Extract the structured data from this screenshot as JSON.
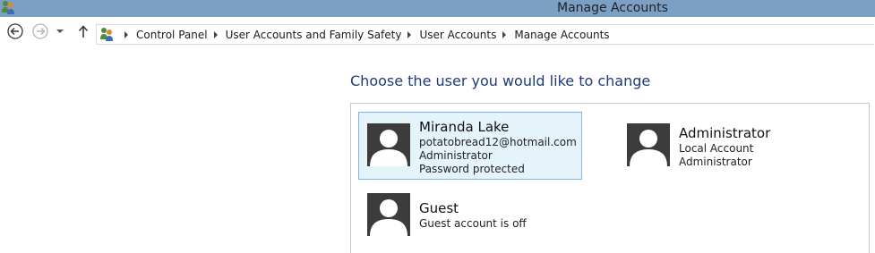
{
  "window": {
    "title": "Manage Accounts"
  },
  "icons": {
    "app": "user-accounts-icon",
    "back": "back-arrow-icon",
    "forward": "forward-arrow-icon",
    "recent": "chevron-down-icon",
    "up": "up-arrow-icon",
    "address": "user-accounts-icon"
  },
  "breadcrumb": [
    "Control Panel",
    "User Accounts and Family Safety",
    "User Accounts",
    "Manage Accounts"
  ],
  "heading": "Choose the user you would like to change",
  "accounts": [
    {
      "name": "Miranda Lake",
      "lines": [
        "potatobread12@hotmail.com",
        "Administrator",
        "Password protected"
      ],
      "selected": true
    },
    {
      "name": "Administrator",
      "lines": [
        "Local Account",
        "Administrator"
      ],
      "selected": false
    },
    {
      "name": "Guest",
      "lines": [
        "Guest account is off"
      ],
      "selected": false
    }
  ],
  "colors": {
    "titlebar": "#7c9fc4",
    "heading": "#1e3b7d",
    "selected_bg": "#e5f3fb",
    "selected_border": "#7eb4ea",
    "avatar": "#3c3c3c"
  }
}
